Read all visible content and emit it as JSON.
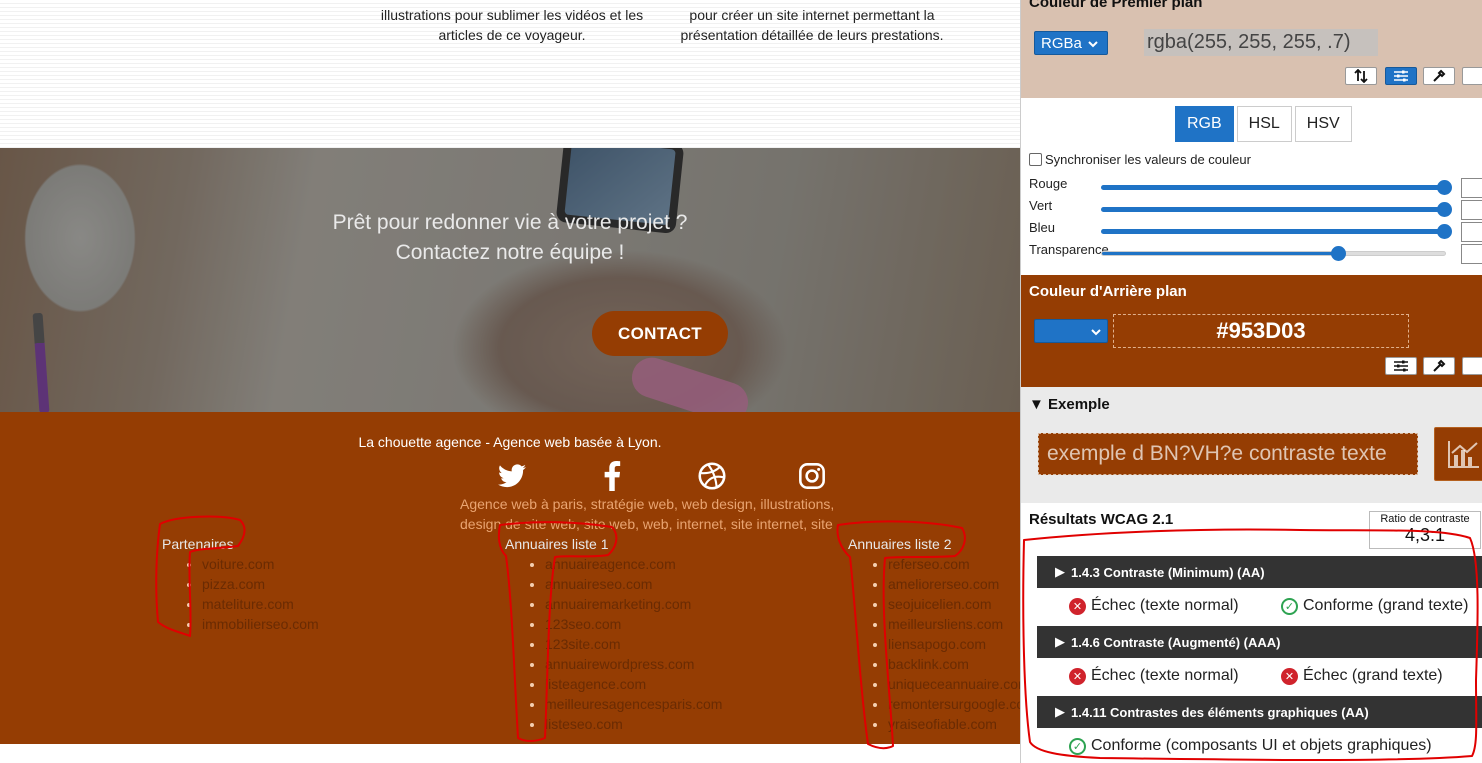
{
  "site": {
    "desc_left": "illustrations pour sublimer les vidéos et les articles de ce voyageur.",
    "desc_right": "pour créer un site internet permettant la présentation détaillée de leurs prestations.",
    "hero_line1": "Prêt pour redonner vie à votre projet ?",
    "hero_line2": "Contactez notre équipe !",
    "contact_label": "CONTACT",
    "tagline": "La chouette agence - Agence web basée à Lyon.",
    "socials": [
      "twitter-icon",
      "facebook-icon",
      "dribbble-icon",
      "instagram-icon"
    ],
    "keywords": "Agence web à paris, stratégie web, web design, illustrations, design de site web, site web, web, internet, site internet, site",
    "columns": [
      {
        "title": "Partenaires",
        "items": [
          "voiture.com",
          "pizza.com",
          "mateliture.com",
          "immobilierseo.com"
        ]
      },
      {
        "title": "Annuaires liste 1",
        "items": [
          "annuaireagence.com",
          "annuaireseo.com",
          "annuairemarketing.com",
          "123seo.com",
          "123site.com",
          "annuairewordpress.com",
          "listeagence.com",
          "meilleuresagencesparis.com",
          "listeseo.com"
        ]
      },
      {
        "title": "Annuaires liste 2",
        "items": [
          "referseo.com",
          "ameliorerseo.com",
          "seojuicelien.com",
          "meilleursliens.com",
          "liensapogo.com",
          "backlink.com",
          "uniqueceannuaire.com",
          "remontersurgoogle.com",
          "yraiseofiable.com"
        ]
      }
    ],
    "colors": {
      "brand": "#953D03",
      "keywords": "#e9a471"
    }
  },
  "panel": {
    "fg_title": "Couleur de Premier plan",
    "fg_format": "RGBa",
    "fg_value": "rgba(255, 255, 255, .7)",
    "modes": [
      "RGB",
      "HSL",
      "HSV"
    ],
    "active_mode": "RGB",
    "sync_label": "Synchroniser les valeurs de couleur",
    "sliders": [
      {
        "label": "Rouge",
        "value": 255
      },
      {
        "label": "Vert",
        "value": 255
      },
      {
        "label": "Bleu",
        "value": 255
      },
      {
        "label": "Transparence",
        "value": 0.7
      }
    ],
    "bg_title": "Couleur d'Arrière plan",
    "bg_value": "#953D03",
    "example_title": "▼ Exemple",
    "example_text": "exemple d BN?VH?e contraste texte",
    "results_title": "Résultats WCAG 2.1",
    "ratio_label": "Ratio de contraste",
    "ratio_value": "4,3:1",
    "criteria": [
      {
        "title": "1.4.3 Contraste (Minimum) (AA)",
        "normal": "Échec (texte normal)",
        "normal_status": "fail",
        "large": "Conforme (grand texte)",
        "large_status": "pass"
      },
      {
        "title": "1.4.6 Contraste (Augmenté) (AAA)",
        "normal": "Échec (texte normal)",
        "normal_status": "fail",
        "large": "Échec (grand texte)",
        "large_status": "fail"
      },
      {
        "title": "1.4.11 Contrastes des éléments graphiques (AA)",
        "normal": "Conforme (composants UI et objets graphiques)",
        "normal_status": "pass",
        "large": "",
        "large_status": ""
      }
    ]
  }
}
